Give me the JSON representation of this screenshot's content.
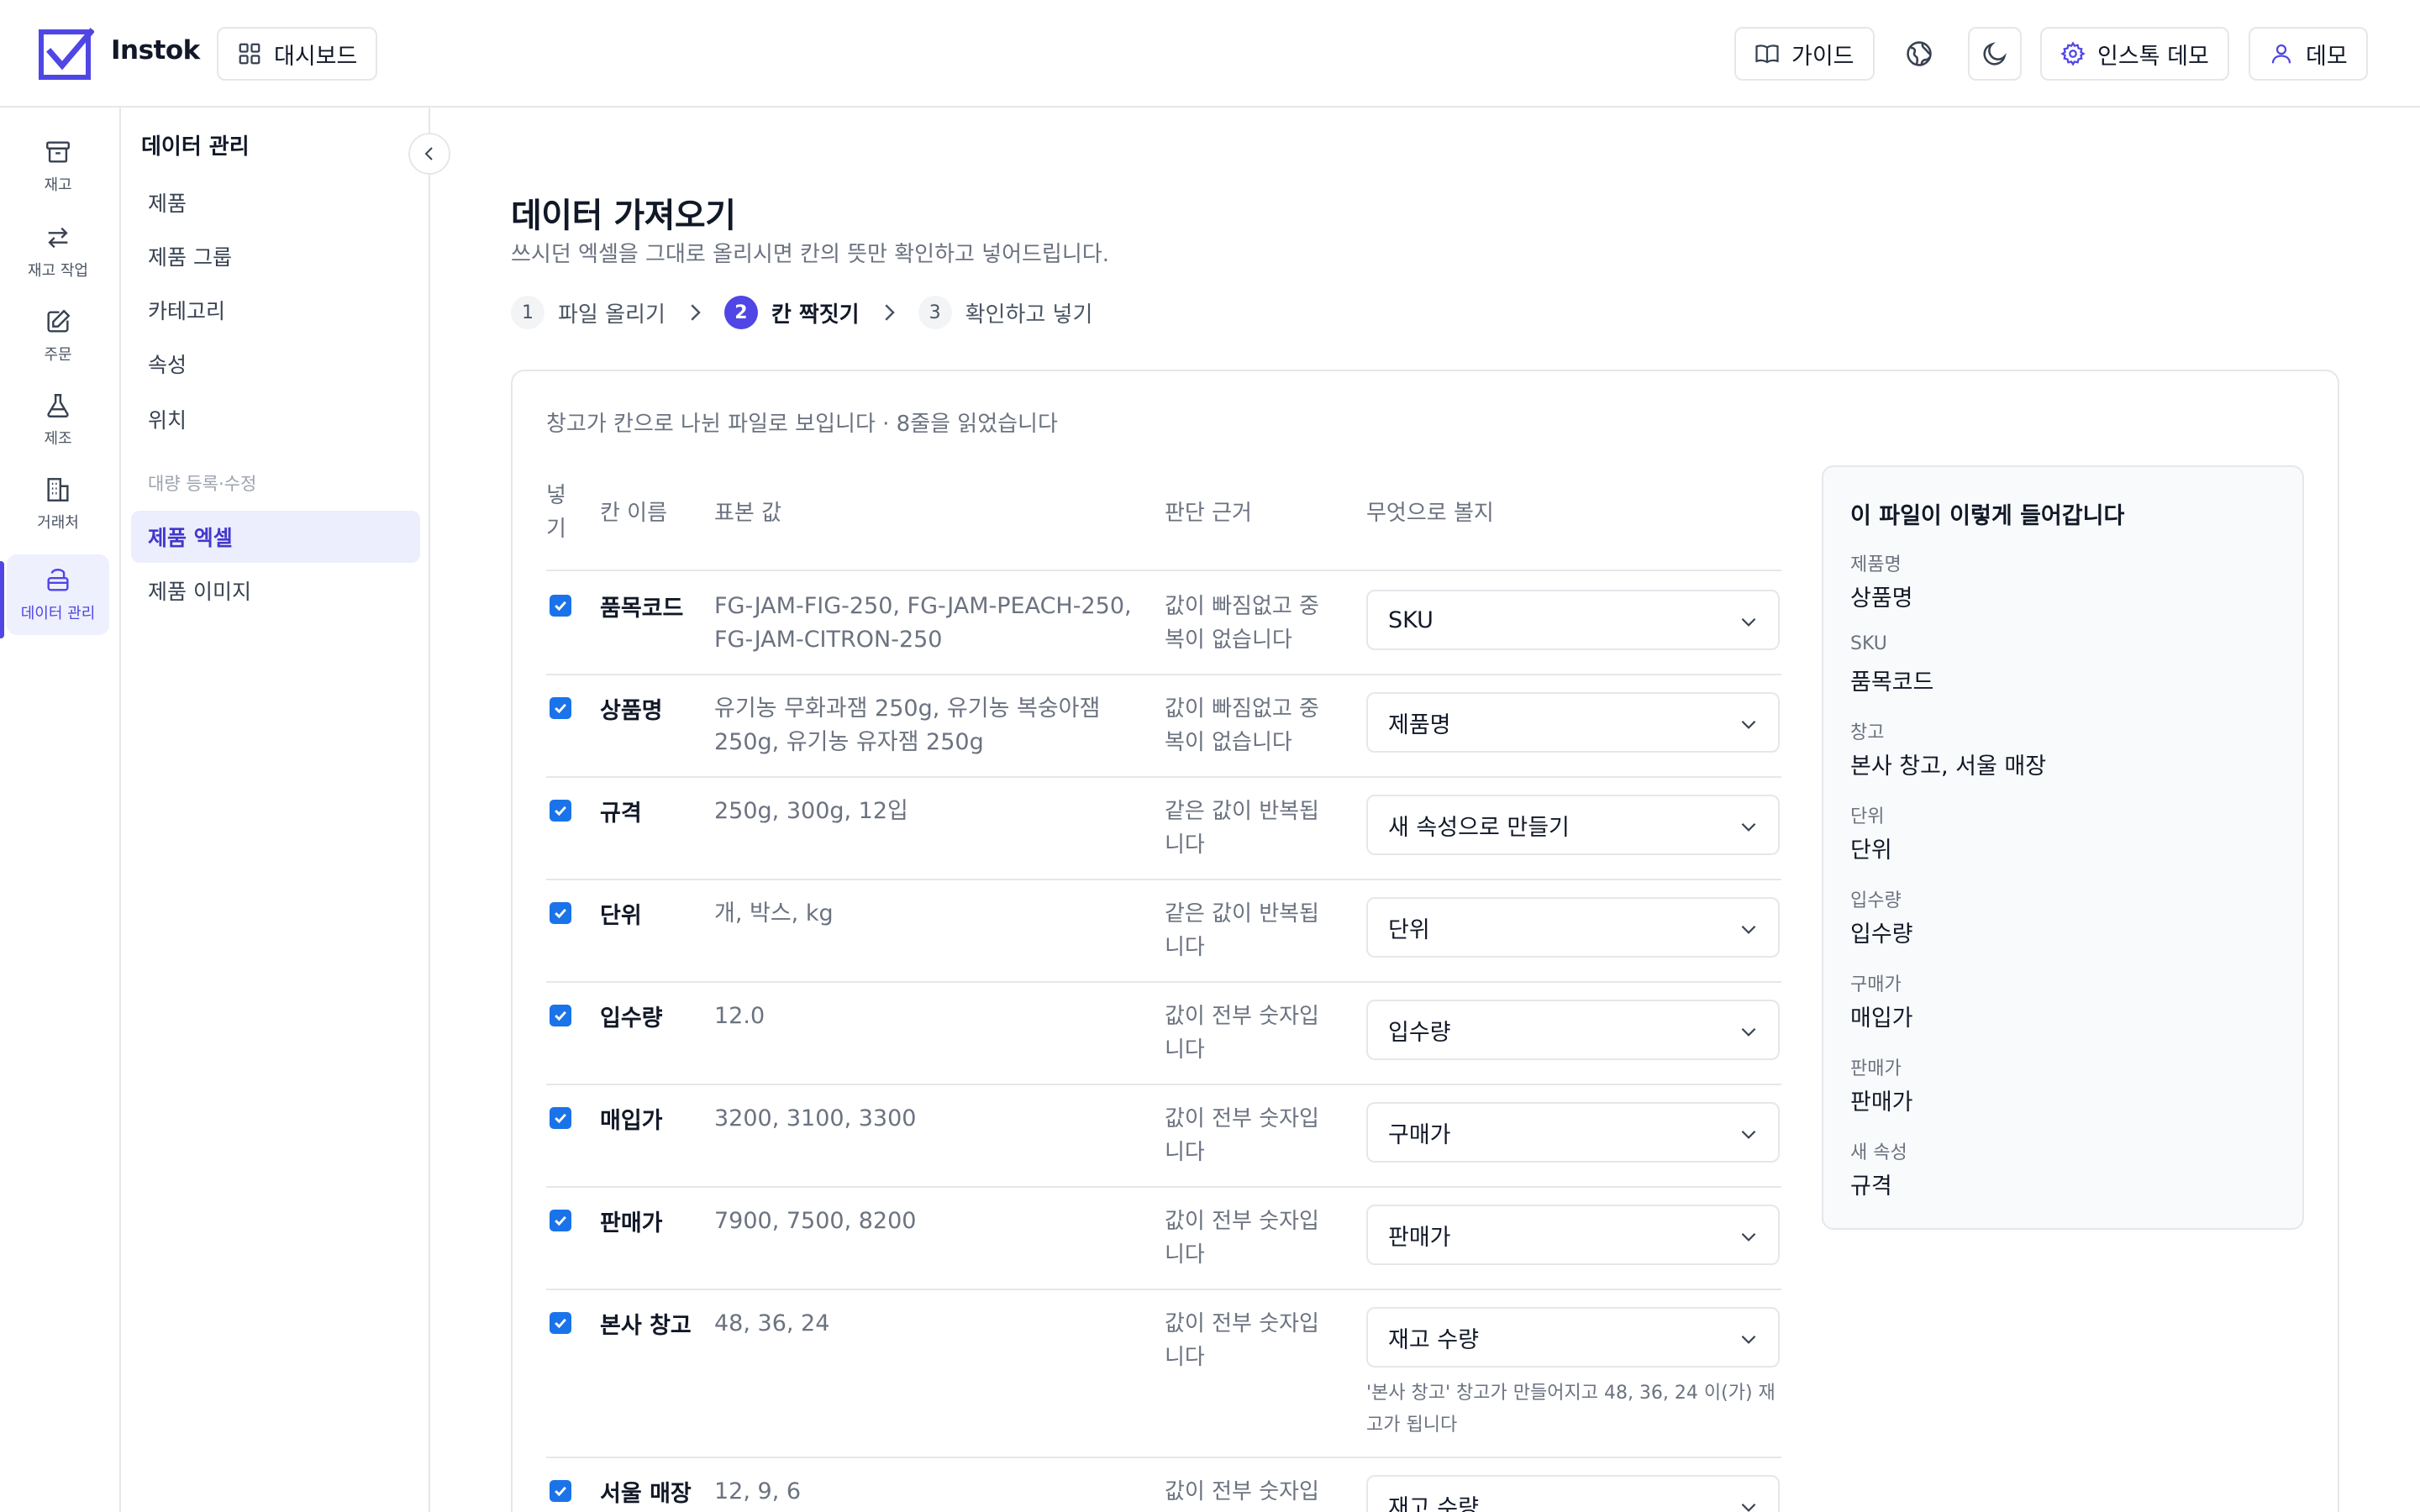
{
  "header": {
    "brand": "Instok",
    "dashboard_label": "대시보드",
    "guide_label": "가이드",
    "workspace_label": "인스톡 데모",
    "user_label": "데모"
  },
  "rail": {
    "items": [
      {
        "label": "재고"
      },
      {
        "label": "재고 작업"
      },
      {
        "label": "주문"
      },
      {
        "label": "제조"
      },
      {
        "label": "거래처"
      },
      {
        "label": "데이터 관리"
      }
    ]
  },
  "subnav": {
    "title": "데이터 관리",
    "items": [
      "제품",
      "제품 그룹",
      "카테고리",
      "속성",
      "위치"
    ],
    "section_label": "대량 등록·수정",
    "section_items": [
      "제품 엑셀",
      "제품 이미지"
    ]
  },
  "page": {
    "title": "데이터 가져오기",
    "subtitle": "쓰시던 엑셀을 그대로 올리시면 칸의 뜻만 확인하고 넣어드립니다."
  },
  "steps": [
    {
      "num": "1",
      "label": "파일 올리기"
    },
    {
      "num": "2",
      "label": "칸 짝짓기"
    },
    {
      "num": "3",
      "label": "확인하고 넣기"
    }
  ],
  "card": {
    "note": "창고가 칸으로 나뉜 파일로 보입니다 · 8줄을 읽었습니다",
    "headers": {
      "include": "넣기",
      "column_name": "칸 이름",
      "sample": "표본 값",
      "reason": "판단 근거",
      "mapping": "무엇으로 볼지"
    },
    "rows": [
      {
        "name": "품목코드",
        "sample": "FG-JAM-FIG-250, FG-JAM-PEACH-250, FG-JAM-CITRON-250",
        "reason": "값이 빠짐없고 중복이 없습니다",
        "mapping": "SKU",
        "hint": ""
      },
      {
        "name": "상품명",
        "sample": "유기농 무화과잼 250g, 유기농 복숭아잼 250g, 유기농 유자잼 250g",
        "reason": "값이 빠짐없고 중복이 없습니다",
        "mapping": "제품명",
        "hint": ""
      },
      {
        "name": "규격",
        "sample": "250g, 300g, 12입",
        "reason": "같은 값이 반복됩니다",
        "mapping": "새 속성으로 만들기",
        "hint": ""
      },
      {
        "name": "단위",
        "sample": "개, 박스, kg",
        "reason": "같은 값이 반복됩니다",
        "mapping": "단위",
        "hint": ""
      },
      {
        "name": "입수량",
        "sample": "12.0",
        "reason": "값이 전부 숫자입니다",
        "mapping": "입수량",
        "hint": ""
      },
      {
        "name": "매입가",
        "sample": "3200, 3100, 3300",
        "reason": "값이 전부 숫자입니다",
        "mapping": "구매가",
        "hint": ""
      },
      {
        "name": "판매가",
        "sample": "7900, 7500, 8200",
        "reason": "값이 전부 숫자입니다",
        "mapping": "판매가",
        "hint": ""
      },
      {
        "name": "본사 창고",
        "sample": "48, 36, 24",
        "reason": "값이 전부 숫자입니다",
        "mapping": "재고 수량",
        "hint": "'본사 창고' 창고가 만들어지고 48, 36, 24 이(가) 재고가 됩니다"
      },
      {
        "name": "서울 매장",
        "sample": "12, 9, 6",
        "reason": "값이 전부 숫자입니다",
        "mapping": "재고 수량",
        "hint": ""
      }
    ]
  },
  "preview": {
    "title": "이 파일이 이렇게 들어갑니다",
    "fields": [
      {
        "label": "제품명",
        "value": "상품명"
      },
      {
        "label": "SKU",
        "value": "품목코드"
      },
      {
        "label": "창고",
        "value": "본사 창고, 서울 매장"
      },
      {
        "label": "단위",
        "value": "단위"
      },
      {
        "label": "입수량",
        "value": "입수량"
      },
      {
        "label": "구매가",
        "value": "매입가"
      },
      {
        "label": "판매가",
        "value": "판매가"
      },
      {
        "label": "새 속성",
        "value": "규격"
      }
    ]
  },
  "colors": {
    "accent": "#4f46e5",
    "checkbox": "#1a73e8"
  }
}
